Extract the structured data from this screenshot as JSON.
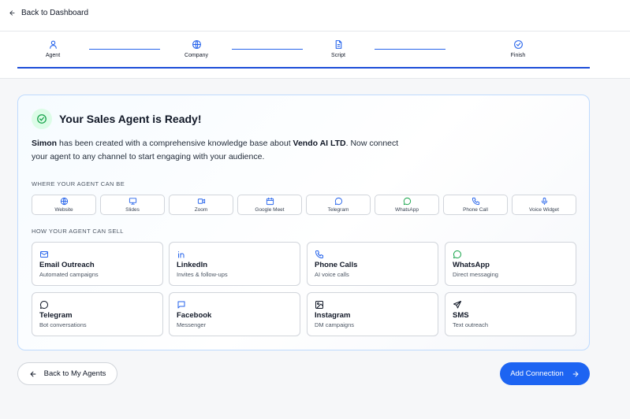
{
  "nav": {
    "back_label": "Back to Dashboard"
  },
  "stepper": {
    "steps": [
      {
        "label": "Agent",
        "icon": "user-icon"
      },
      {
        "label": "Company",
        "icon": "globe-icon"
      },
      {
        "label": "Script",
        "icon": "document-icon"
      },
      {
        "label": "Finish",
        "icon": "check-circle-icon"
      }
    ]
  },
  "card": {
    "title": "Your Sales Agent is Ready!",
    "agent_name": "Simon",
    "desc_part1": " has been created with a comprehensive knowledge base about ",
    "company_name": "Vendo AI LTD",
    "desc_part2": ". Now connect your agent to any channel to start engaging with your audience.",
    "where_label": "WHERE YOUR AGENT CAN BE",
    "how_label": "HOW YOUR AGENT CAN SELL",
    "channels": [
      {
        "label": "Website",
        "icon": "globe-icon"
      },
      {
        "label": "Slides",
        "icon": "presentation-icon"
      },
      {
        "label": "Zoom",
        "icon": "video-icon"
      },
      {
        "label": "Google Meet",
        "icon": "calendar-icon"
      },
      {
        "label": "Telegram",
        "icon": "chat-bubble-icon"
      },
      {
        "label": "WhatsApp",
        "icon": "whatsapp-icon"
      },
      {
        "label": "Phone Call",
        "icon": "phone-icon"
      },
      {
        "label": "Voice Widget",
        "icon": "microphone-icon"
      }
    ],
    "sell": [
      {
        "title": "Email Outreach",
        "sub": "Automated campaigns",
        "icon": "mail-icon"
      },
      {
        "title": "LinkedIn",
        "sub": "Invites & follow-ups",
        "icon": "linkedin-icon"
      },
      {
        "title": "Phone Calls",
        "sub": "AI voice calls",
        "icon": "phone-icon"
      },
      {
        "title": "WhatsApp",
        "sub": "Direct messaging",
        "icon": "whatsapp-icon"
      },
      {
        "title": "Telegram",
        "sub": "Bot conversations",
        "icon": "chat-bubble-icon"
      },
      {
        "title": "Facebook",
        "sub": "Messenger",
        "icon": "message-square-icon"
      },
      {
        "title": "Instagram",
        "sub": "DM campaigns",
        "icon": "image-icon"
      },
      {
        "title": "SMS",
        "sub": "Text outreach",
        "icon": "send-icon"
      }
    ]
  },
  "actions": {
    "back_agents_label": "Back to My Agents",
    "add_connection_label": "Add Connection"
  },
  "colors": {
    "primary": "#1d64f2",
    "success": "#16a34a",
    "accent_blue": "#2563eb"
  }
}
